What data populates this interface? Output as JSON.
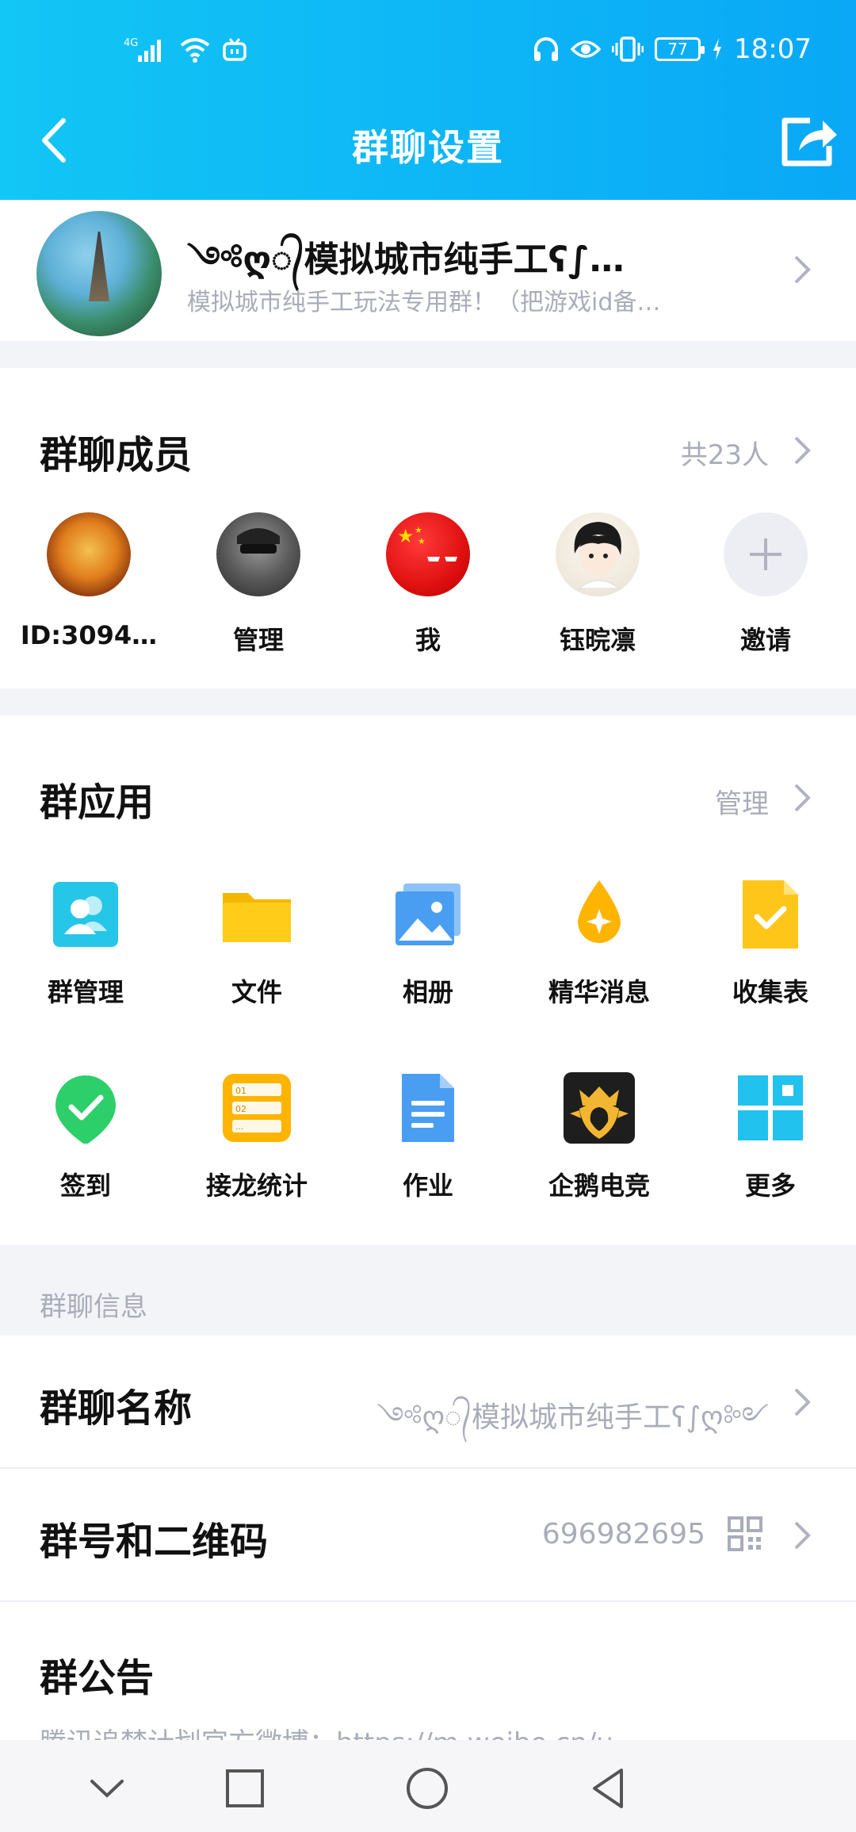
{
  "status_bar": {
    "network": "4G",
    "battery": "77",
    "time": "18:07"
  },
  "header": {
    "title": "群聊设置"
  },
  "group": {
    "name": "༺ღ᭄模拟城市纯手工ʕ∫…",
    "description": "模拟城市纯手工玩法专用群！（把游戏id备…"
  },
  "members": {
    "title": "群聊成员",
    "count": "共23人",
    "items": [
      {
        "label": "ID:3094…",
        "style": "autumn"
      },
      {
        "label": "管理",
        "style": "dark"
      },
      {
        "label": "我",
        "style": "red"
      },
      {
        "label": "钰晥凛",
        "style": "anime"
      },
      {
        "label": "邀请",
        "style": "invite"
      }
    ]
  },
  "apps": {
    "title": "群应用",
    "manage": "管理",
    "items": [
      {
        "label": "群管理",
        "icon": "group-manage-icon"
      },
      {
        "label": "文件",
        "icon": "folder-icon"
      },
      {
        "label": "相册",
        "icon": "album-icon"
      },
      {
        "label": "精华消息",
        "icon": "essence-icon"
      },
      {
        "label": "收集表",
        "icon": "collect-form-icon"
      },
      {
        "label": "签到",
        "icon": "checkin-icon"
      },
      {
        "label": "接龙统计",
        "icon": "solitaire-icon"
      },
      {
        "label": "作业",
        "icon": "homework-icon"
      },
      {
        "label": "企鹅电竞",
        "icon": "esports-icon"
      },
      {
        "label": "更多",
        "icon": "more-grid-icon"
      }
    ]
  },
  "info": {
    "section_label": "群聊信息",
    "group_name_label": "群聊名称",
    "group_name_value": "༺ღ᭄模拟城市纯手工ʕ∫ღ༻",
    "group_number_label": "群号和二维码",
    "group_number_value": "696982695",
    "notice_label": "群公告",
    "notice_value": "腾讯追梦计划官方微博：https://m.weibo.cn/u"
  },
  "colors": {
    "header_start": "#12c6f5",
    "header_end": "#0aa8f6",
    "muted_text": "#a9adb9"
  }
}
